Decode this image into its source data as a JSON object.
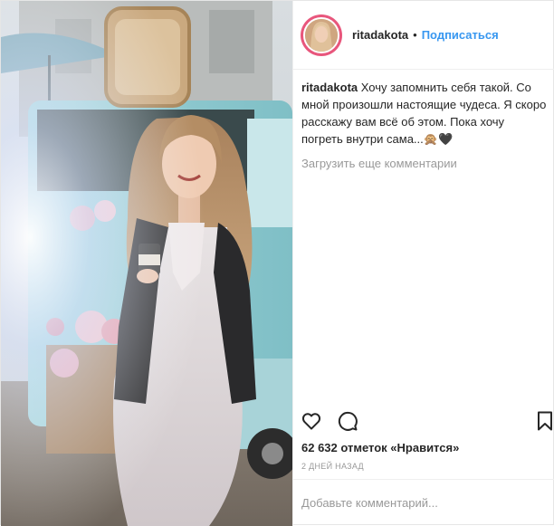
{
  "post": {
    "author": {
      "username": "ritadakota",
      "separator": "•",
      "follow_label": "Подписаться"
    },
    "caption": {
      "username": "ritadakota",
      "text": "Хочу запомнить себя такой. Со мной произошли настоящие чудеса. Я скоро расскажу вам всё об этом. Пока хочу погреть внутри сама...🙊🖤"
    },
    "load_more_label": "Загрузить еще комментарии",
    "actions": {
      "like_icon": "heart-outline-icon",
      "comment_icon": "speech-bubble-icon",
      "save_icon": "bookmark-outline-icon"
    },
    "likes_text": "62 632 отметок «Нравится»",
    "date_text": "2 дней назад",
    "add_comment_placeholder": "Добавьте комментарий...",
    "colors": {
      "link": "#3897f0",
      "muted": "#999999",
      "border": "#efefef",
      "avatar_ring": "#e8567c"
    }
  }
}
